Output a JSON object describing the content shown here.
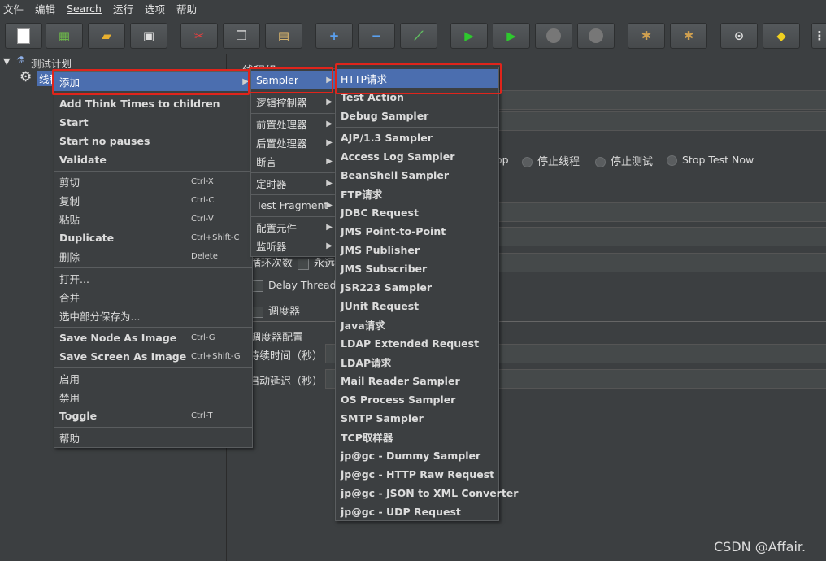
{
  "menubar": [
    "文件",
    "编辑",
    "Search",
    "运行",
    "选项",
    "帮助"
  ],
  "toolbar_icons": [
    "new-icon",
    "templates-icon",
    "open-icon",
    "save-icon",
    "cut-icon",
    "copy-icon",
    "paste-icon",
    "expand-icon",
    "collapse-icon",
    "toggle-icon",
    "start-icon",
    "start-no-pauses-icon",
    "stop-icon",
    "shutdown-icon",
    "clear-icon",
    "clear-all-icon",
    "search-icon",
    "reset-search-icon",
    "more-icon"
  ],
  "tree": {
    "root": "测试计划",
    "child": "线程组"
  },
  "right_panel": {
    "title": "线程组",
    "radio_options": [
      "op",
      "停止线程",
      "停止测试",
      "Stop Test Now"
    ],
    "loop_label": "循环次数",
    "forever_label": "永远",
    "delay_label": "Delay Thread c",
    "scheduler_label": "调度器",
    "scheduler_config": "调度器配置",
    "duration_label": "持续时间（秒）",
    "startup_delay_label": "启动延迟（秒）"
  },
  "context_menu": {
    "items": [
      {
        "label": "添加",
        "shortcut": "",
        "submenu": true,
        "highlight": true
      },
      {
        "label": "Add Think Times to children",
        "shortcut": ""
      },
      {
        "label": "Start",
        "shortcut": ""
      },
      {
        "label": "Start no pauses",
        "shortcut": ""
      },
      {
        "label": "Validate",
        "shortcut": ""
      },
      {
        "label": "剪切",
        "shortcut": "Ctrl-X"
      },
      {
        "label": "复制",
        "shortcut": "Ctrl-C"
      },
      {
        "label": "粘贴",
        "shortcut": "Ctrl-V"
      },
      {
        "label": "Duplicate",
        "shortcut": "Ctrl+Shift-C"
      },
      {
        "label": "删除",
        "shortcut": "Delete"
      },
      {
        "label": "打开...",
        "shortcut": ""
      },
      {
        "label": "合并",
        "shortcut": ""
      },
      {
        "label": "选中部分保存为...",
        "shortcut": ""
      },
      {
        "label": "Save Node As Image",
        "shortcut": "Ctrl-G"
      },
      {
        "label": "Save Screen As Image",
        "shortcut": "Ctrl+Shift-G"
      },
      {
        "label": "启用",
        "shortcut": ""
      },
      {
        "label": "禁用",
        "shortcut": ""
      },
      {
        "label": "Toggle",
        "shortcut": "Ctrl-T"
      },
      {
        "label": "帮助",
        "shortcut": ""
      }
    ]
  },
  "add_submenu": {
    "items": [
      {
        "label": "Sampler",
        "highlight": true
      },
      {
        "label": "逻辑控制器"
      },
      {
        "label": "前置处理器"
      },
      {
        "label": "后置处理器"
      },
      {
        "label": "断言"
      },
      {
        "label": "定时器"
      },
      {
        "label": "Test Fragment"
      },
      {
        "label": "配置元件"
      },
      {
        "label": "监听器"
      }
    ]
  },
  "sampler_submenu": {
    "items": [
      "HTTP请求",
      "Test Action",
      "Debug Sampler",
      "AJP/1.3 Sampler",
      "Access Log Sampler",
      "BeanShell Sampler",
      "FTP请求",
      "JDBC Request",
      "JMS Point-to-Point",
      "JMS Publisher",
      "JMS Subscriber",
      "JSR223 Sampler",
      "JUnit Request",
      "Java请求",
      "LDAP Extended Request",
      "LDAP请求",
      "Mail Reader Sampler",
      "OS Process Sampler",
      "SMTP Sampler",
      "TCP取样器",
      "jp@gc - Dummy Sampler",
      "jp@gc - HTTP Raw Request",
      "jp@gc - JSON to XML Converter",
      "jp@gc - UDP Request"
    ]
  },
  "watermark": "CSDN @Affair.",
  "colors": {
    "background": "#3c3f41",
    "highlight": "#4b6eaf",
    "annotation_red": "#e0241b"
  }
}
